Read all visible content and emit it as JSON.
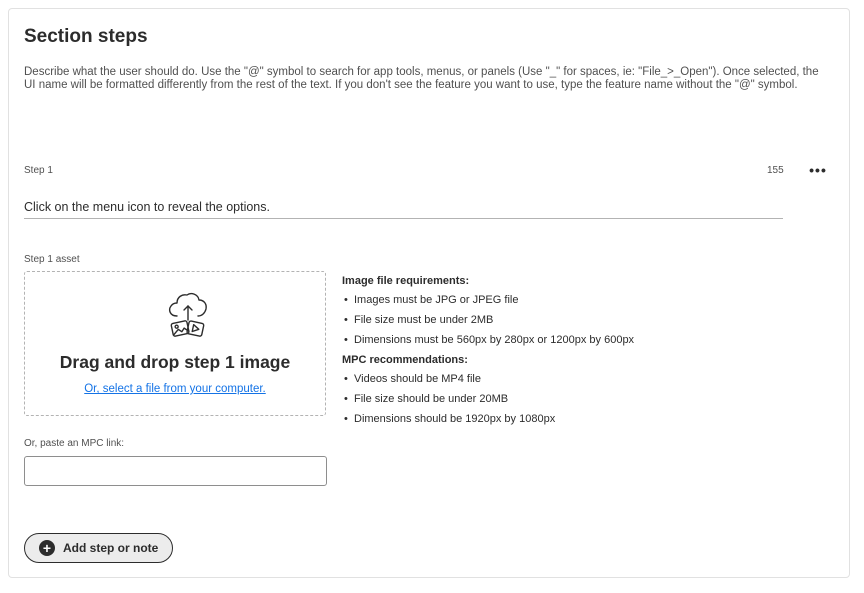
{
  "section": {
    "title": "Section steps",
    "description": "Describe what the user should do. Use the \"@\" symbol to search for app tools, menus, or panels (Use \"_\" for spaces, ie: \"File_>_Open\"). Once selected, the UI name will be formatted differently from the rest of the text. If you don't see the feature you want to use, type the feature name without the \"@\" symbol."
  },
  "step": {
    "label": "Step 1",
    "char_count": "155",
    "more_icon": "ellipsis-icon",
    "text_value": "Click on the menu icon to reveal the options."
  },
  "asset": {
    "label": "Step 1 asset",
    "icon": "cloud-upload-media-icon",
    "drop_title": "Drag and drop step 1 image",
    "select_link": "Or, select a file from your computer."
  },
  "requirements": {
    "image_heading": "Image file requirements:",
    "image_items": [
      "Images must be JPG or JPEG file",
      "File size must be under 2MB",
      "Dimensions must be 560px by 280px or 1200px by 600px"
    ],
    "mpc_heading": "MPC recommendations:",
    "mpc_items": [
      "Videos should be MP4 file",
      "File size should be under 20MB",
      "Dimensions should be 1920px by 1080px"
    ],
    "bullet": "•"
  },
  "mpc": {
    "label": "Or, paste an MPC link:",
    "value": ""
  },
  "add_button": {
    "icon": "plus-circle-icon",
    "label": "Add step or note"
  },
  "colors": {
    "link": "#1473e6",
    "text": "#2c2c2c",
    "button_bg": "#ececec"
  }
}
